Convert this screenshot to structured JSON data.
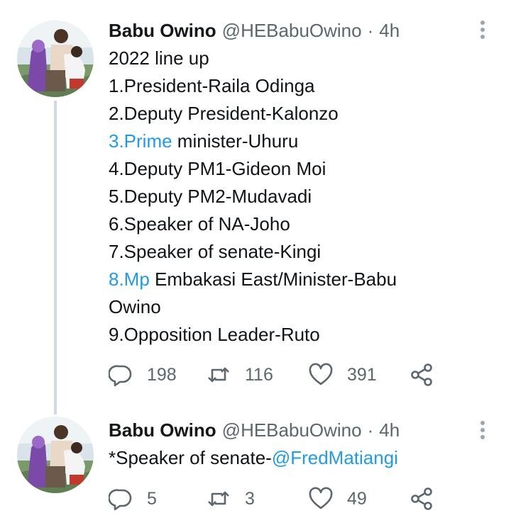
{
  "tweets": [
    {
      "author": {
        "display_name": "Babu Owino",
        "handle": "@HEBabuOwino"
      },
      "separator": "·",
      "time": "4h",
      "body": {
        "line1": "2022 line up",
        "line2": "1.President-Raila Odinga",
        "line3": "2.Deputy President-Kalonzo",
        "line4_link": "3.Prime",
        "line4_rest": " minister-Uhuru",
        "line5": "4.Deputy PM1-Gideon Moi",
        "line6": "5.Deputy PM2-Mudavadi",
        "line7": "6.Speaker of NA-Joho",
        "line8": "7.Speaker of senate-Kingi",
        "line9_link": "8.Mp",
        "line9_rest": " Embakasi East/Minister-Babu",
        "line10": "Owino",
        "line11": "9.Opposition Leader-Ruto"
      },
      "stats": {
        "replies": "198",
        "retweets": "116",
        "likes": "391"
      },
      "icons": [
        "reply-icon",
        "retweet-icon",
        "like-icon",
        "share-icon",
        "more-options-icon"
      ]
    },
    {
      "author": {
        "display_name": "Babu Owino",
        "handle": "@HEBabuOwino"
      },
      "separator": "·",
      "time": "4h",
      "body": {
        "prefix": "*Speaker of senate-",
        "mention": "@FredMatiangi"
      },
      "stats": {
        "replies": "5",
        "retweets": "3",
        "likes": "49"
      }
    }
  ],
  "colors": {
    "link": "#1d9bf0",
    "secondary_text": "#5b6670",
    "thread_line": "#cfd9de"
  }
}
